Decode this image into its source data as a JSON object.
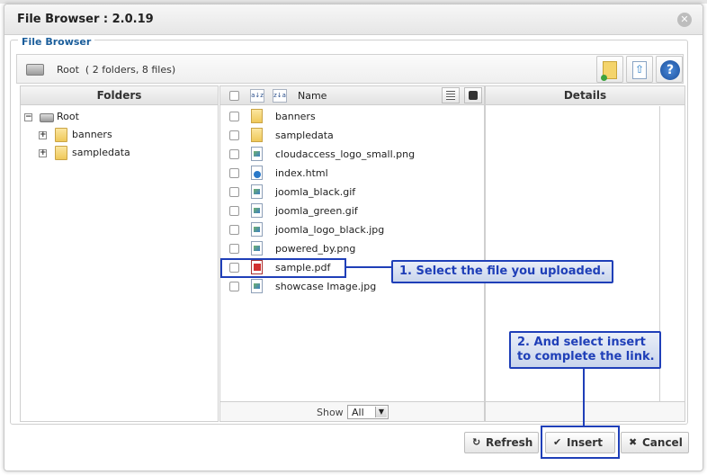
{
  "dialog": {
    "title": "File Browser : 2.0.19",
    "legend": "File Browser"
  },
  "pathbar": {
    "root_label": "Root",
    "summary": "( 2 folders, 8 files)"
  },
  "columns": {
    "folders": "Folders",
    "name": "Name",
    "details": "Details"
  },
  "tree": {
    "root": "Root",
    "folders": [
      "banners",
      "sampledata"
    ]
  },
  "files": [
    {
      "name": "banners",
      "icon": "folder-icon"
    },
    {
      "name": "sampledata",
      "icon": "folder-icon"
    },
    {
      "name": "cloudaccess_logo_small.png",
      "icon": "image-file-icon"
    },
    {
      "name": "index.html",
      "icon": "html-file-icon"
    },
    {
      "name": "joomla_black.gif",
      "icon": "image-file-icon"
    },
    {
      "name": "joomla_green.gif",
      "icon": "image-file-icon"
    },
    {
      "name": "joomla_logo_black.jpg",
      "icon": "image-file-icon"
    },
    {
      "name": "powered_by.png",
      "icon": "image-file-icon"
    },
    {
      "name": "sample.pdf",
      "icon": "pdf-file-icon"
    },
    {
      "name": "showcase Image.jpg",
      "icon": "image-file-icon"
    }
  ],
  "footer": {
    "show_label": "Show",
    "show_value": "All"
  },
  "callouts": {
    "step1": "1. Select the file you uploaded.",
    "step2_line1": "2. And select insert",
    "step2_line2": "to complete the link."
  },
  "buttons": {
    "refresh": "Refresh",
    "insert": "Insert",
    "cancel": "Cancel"
  },
  "colors": {
    "annotation": "#1f3fb8",
    "legend": "#1b5e9b"
  }
}
